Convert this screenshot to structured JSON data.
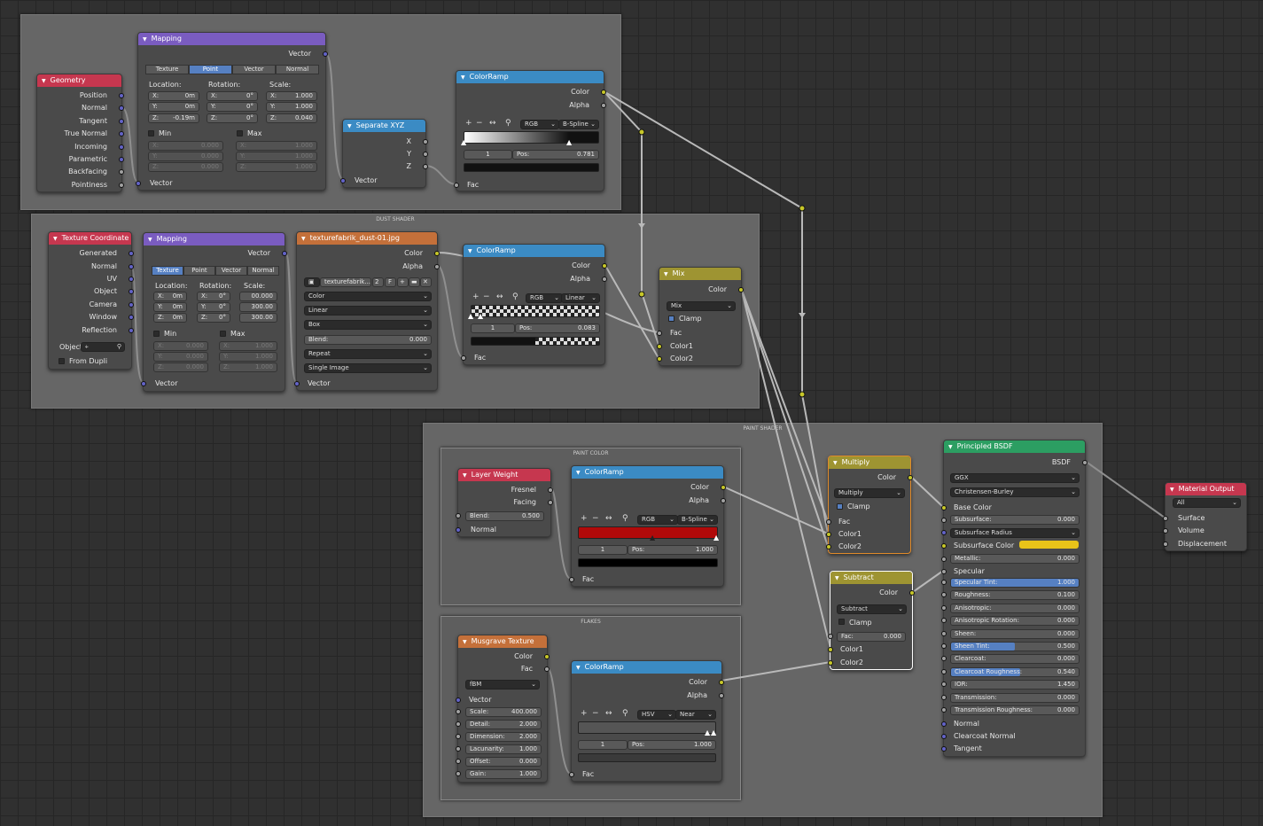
{
  "frames": {
    "dust": "DUST SHADER",
    "paint": "PAINT SHADER",
    "paint_color": "PAINT COLOR",
    "flakes": "FLAKES"
  },
  "geometry": {
    "title": "Geometry",
    "outputs": [
      "Position",
      "Normal",
      "Tangent",
      "True Normal",
      "Incoming",
      "Parametric",
      "Backfacing",
      "Pointiness"
    ]
  },
  "mapping1": {
    "title": "Mapping",
    "out": "Vector",
    "tabs": [
      "Texture",
      "Point",
      "Vector",
      "Normal"
    ],
    "active": "Point",
    "loc_label": "Location:",
    "rot_label": "Rotation:",
    "scale_label": "Scale:",
    "loc": [
      [
        "X:",
        "0m"
      ],
      [
        "Y:",
        "0m"
      ],
      [
        "Z:",
        "-0.19m"
      ]
    ],
    "rot": [
      [
        "X:",
        "0°"
      ],
      [
        "Y:",
        "0°"
      ],
      [
        "Z:",
        "0°"
      ]
    ],
    "scale": [
      [
        "X:",
        "1.000"
      ],
      [
        "Y:",
        "1.000"
      ],
      [
        "Z:",
        "0.040"
      ]
    ],
    "min": "Min",
    "max": "Max",
    "min_vals": [
      [
        "X:",
        "0.000"
      ],
      [
        "Y:",
        "0.000"
      ],
      [
        "Z:",
        "0.000"
      ]
    ],
    "max_vals": [
      [
        "X:",
        "1.000"
      ],
      [
        "Y:",
        "1.000"
      ],
      [
        "Z:",
        "1.000"
      ]
    ],
    "in": "Vector"
  },
  "sepxyz": {
    "title": "Separate XYZ",
    "outputs": [
      "X",
      "Y",
      "Z"
    ],
    "in": "Vector"
  },
  "ramp1": {
    "title": "ColorRamp",
    "outputs": [
      "Color",
      "Alpha"
    ],
    "mode": "RGB",
    "interp": "B-Spline",
    "index": "1",
    "pos_label": "Pos:",
    "pos": "0.781",
    "in": "Fac"
  },
  "texcoord": {
    "title": "Texture Coordinate",
    "outputs": [
      "Generated",
      "Normal",
      "UV",
      "Object",
      "Camera",
      "Window",
      "Reflection"
    ],
    "object_label": "Object:",
    "from_dupli": "From Dupli"
  },
  "mapping2": {
    "title": "Mapping",
    "out": "Vector",
    "tabs": [
      "Texture",
      "Point",
      "Vector",
      "Normal"
    ],
    "active": "Texture",
    "loc_label": "Location:",
    "rot_label": "Rotation:",
    "scale_label": "Scale:",
    "loc": [
      [
        "X:",
        "0m"
      ],
      [
        "Y:",
        "0m"
      ],
      [
        "Z:",
        "0m"
      ]
    ],
    "rot": [
      [
        "X:",
        "0°"
      ],
      [
        "Y:",
        "0°"
      ],
      [
        "Z:",
        "0°"
      ]
    ],
    "scale": [
      [
        "",
        "00.000"
      ],
      [
        "",
        "300.00"
      ],
      [
        "",
        "300.00"
      ]
    ],
    "min": "Min",
    "max": "Max",
    "min_vals": [
      [
        "X:",
        "0.000"
      ],
      [
        "Y:",
        "0.000"
      ],
      [
        "Z:",
        "0.000"
      ]
    ],
    "max_vals": [
      [
        "X:",
        "1.000"
      ],
      [
        "Y:",
        "1.000"
      ],
      [
        "Z:",
        "1.000"
      ]
    ],
    "in": "Vector"
  },
  "imgtex": {
    "title": "texturefabrik_dust-01.jpg",
    "outputs": [
      "Color",
      "Alpha"
    ],
    "image": "texturefabrik...",
    "users": "2",
    "fake": "F",
    "color": "Color",
    "interp": "Linear",
    "proj": "Box",
    "blend_label": "Blend:",
    "blend": "0.000",
    "ext": "Repeat",
    "source": "Single Image",
    "in": "Vector"
  },
  "ramp2": {
    "title": "ColorRamp",
    "outputs": [
      "Color",
      "Alpha"
    ],
    "mode": "RGB",
    "interp": "Linear",
    "index": "1",
    "pos_label": "Pos:",
    "pos": "0.083",
    "in": "Fac"
  },
  "mix": {
    "title": "Mix",
    "out": "Color",
    "blend": "Mix",
    "clamp": "Clamp",
    "inputs": [
      "Fac",
      "Color1",
      "Color2"
    ]
  },
  "layerweight": {
    "title": "Layer Weight",
    "outputs": [
      "Fresnel",
      "Facing"
    ],
    "blend_label": "Blend:",
    "blend": "0.500",
    "in": "Normal"
  },
  "ramp3": {
    "title": "ColorRamp",
    "outputs": [
      "Color",
      "Alpha"
    ],
    "mode": "RGB",
    "interp": "B-Spline",
    "index": "1",
    "pos_label": "Pos:",
    "pos": "1.000",
    "in": "Fac"
  },
  "musgrave": {
    "title": "Musgrave Texture",
    "outputs": [
      "Color",
      "Fac"
    ],
    "type": "fBM",
    "vector": "Vector",
    "fields": [
      [
        "Scale:",
        "400.000"
      ],
      [
        "Detail:",
        "2.000"
      ],
      [
        "Dimension:",
        "2.000"
      ],
      [
        "Lacunarity:",
        "1.000"
      ],
      [
        "Offset:",
        "0.000"
      ],
      [
        "Gain:",
        "1.000"
      ]
    ]
  },
  "ramp4": {
    "title": "ColorRamp",
    "outputs": [
      "Color",
      "Alpha"
    ],
    "mode": "HSV",
    "interp": "Near",
    "index": "1",
    "pos_label": "Pos:",
    "pos": "1.000",
    "in": "Fac"
  },
  "multiply": {
    "title": "Multiply",
    "out": "Color",
    "blend": "Multiply",
    "clamp": "Clamp",
    "inputs": [
      "Fac",
      "Color1",
      "Color2"
    ]
  },
  "subtract": {
    "title": "Subtract",
    "out": "Color",
    "blend": "Subtract",
    "clamp": "Clamp",
    "fac_label": "Fac:",
    "fac": "0.000",
    "inputs": [
      "Color1",
      "Color2"
    ]
  },
  "bsdf": {
    "title": "Principled BSDF",
    "out": "BSDF",
    "dist": "GGX",
    "sss": "Christensen-Burley",
    "base_color": "Base Color",
    "subsurface_label": "Subsurface:",
    "subsurface": "0.000",
    "subsurface_radius": "Subsurface Radius",
    "subsurface_color": "Subsurface Color",
    "subsurface_color_hex": "#e8c319",
    "metallic_label": "Metallic:",
    "metallic": "0.000",
    "specular": "Specular",
    "params": [
      {
        "label": "Specular Tint:",
        "value": "1.000",
        "fill": 1.0
      },
      {
        "label": "Roughness:",
        "value": "0.100",
        "fill": 0.0
      },
      {
        "label": "Anisotropic:",
        "value": "0.000",
        "fill": 0.0
      },
      {
        "label": "Anisotropic Rotation:",
        "value": "0.000",
        "fill": 0.0
      },
      {
        "label": "Sheen:",
        "value": "0.000",
        "fill": 0.0
      },
      {
        "label": "Sheen Tint:",
        "value": "0.500",
        "fill": 0.5
      },
      {
        "label": "Clearcoat:",
        "value": "0.000",
        "fill": 0.0
      },
      {
        "label": "Clearcoat Roughness:",
        "value": "0.540",
        "fill": 0.54
      },
      {
        "label": "IOR:",
        "value": "1.450",
        "fill": 0.0
      },
      {
        "label": "Transmission:",
        "value": "0.000",
        "fill": 0.0
      },
      {
        "label": "Transmission Roughness:",
        "value": "0.000",
        "fill": 0.0
      }
    ],
    "inputs_tail": [
      "Normal",
      "Clearcoat Normal",
      "Tangent"
    ]
  },
  "output": {
    "title": "Material Output",
    "target": "All",
    "inputs": [
      "Surface",
      "Volume",
      "Displacement"
    ]
  },
  "icons": {
    "add": "+",
    "remove": "−",
    "flip": "↔",
    "eyedropper": "eyedropper-icon",
    "chevron": "⌄"
  }
}
